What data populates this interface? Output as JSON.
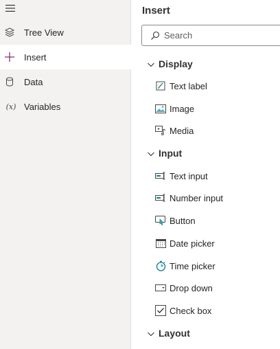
{
  "sidebar": {
    "items": [
      {
        "label": "Tree View",
        "icon": "layers-icon"
      },
      {
        "label": "Insert",
        "icon": "plus-icon",
        "active": true
      },
      {
        "label": "Data",
        "icon": "database-icon"
      },
      {
        "label": "Variables",
        "icon": "variable-icon",
        "glyph": "(x)"
      }
    ]
  },
  "panel": {
    "title": "Insert",
    "search_placeholder": "Search",
    "sections": {
      "display": {
        "label": "Display",
        "items": [
          "Text label",
          "Image",
          "Media"
        ]
      },
      "input": {
        "label": "Input",
        "items": [
          "Text input",
          "Number input",
          "Button",
          "Date picker",
          "Time picker",
          "Drop down",
          "Check box"
        ]
      },
      "layout": {
        "label": "Layout"
      }
    }
  },
  "colors": {
    "sidebar_bg": "#f3f2f1",
    "active_bg": "#ffffff",
    "accent_purple": "#742774",
    "icon_teal": "#0f7b8a"
  }
}
